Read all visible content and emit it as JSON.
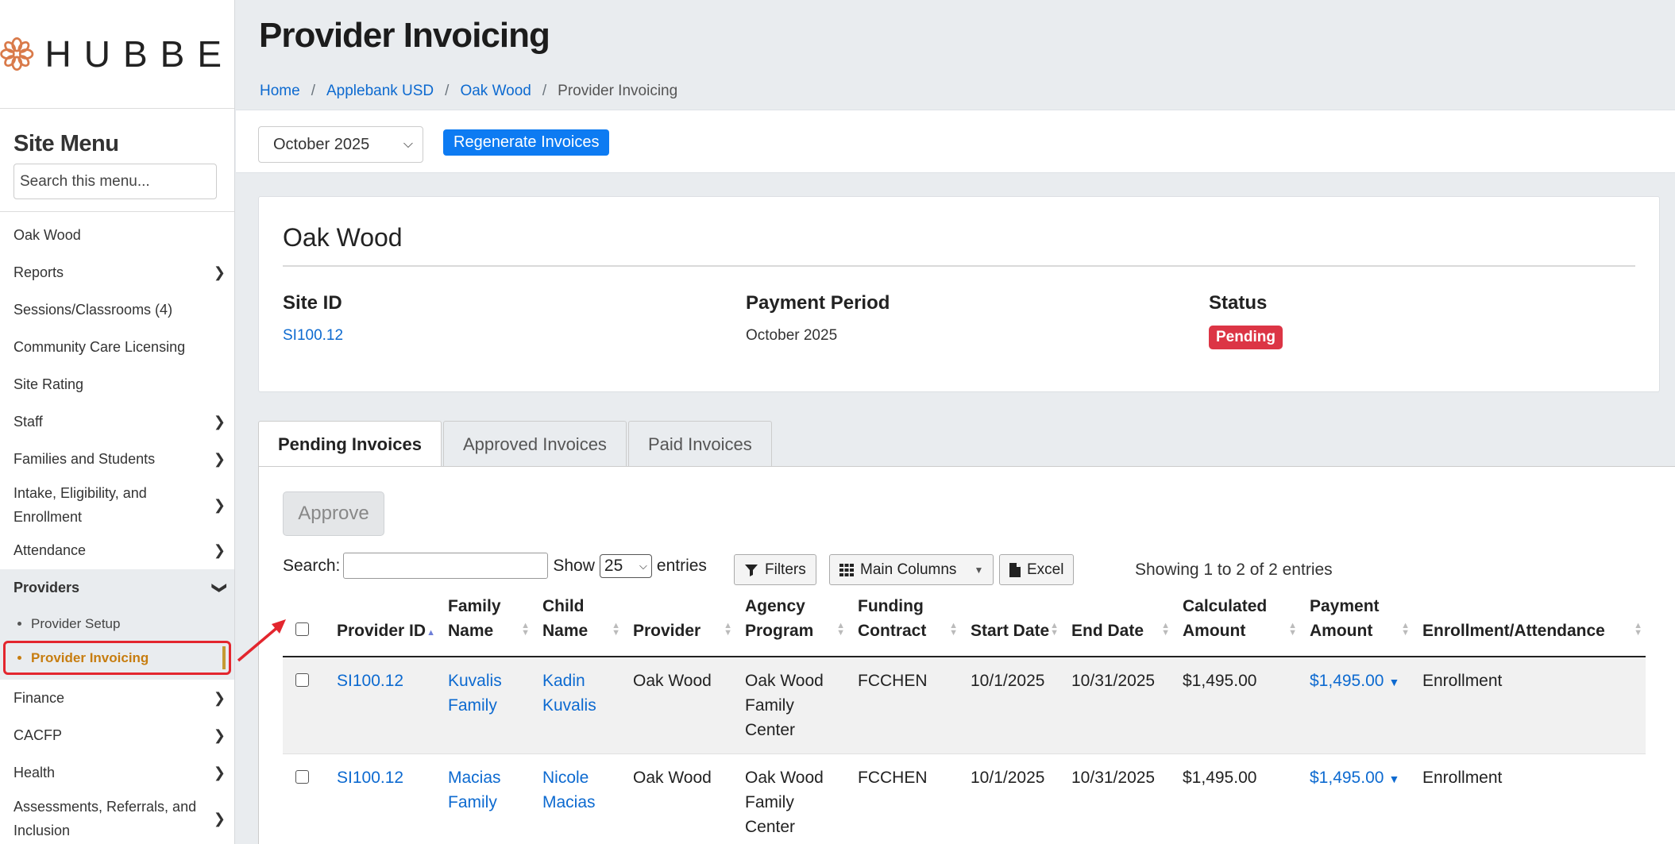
{
  "brand": {
    "logo_text": "HUBBE"
  },
  "sidebar": {
    "title": "Site Menu",
    "search_placeholder": "Search this menu...",
    "items": [
      {
        "label": "Oak Wood",
        "chevron": false
      },
      {
        "label": "Reports",
        "chevron": true
      },
      {
        "label": "Sessions/Classrooms (4)",
        "chevron": false
      },
      {
        "label": "Community Care Licensing",
        "chevron": false
      },
      {
        "label": "Site Rating",
        "chevron": false
      },
      {
        "label": "Staff",
        "chevron": true
      },
      {
        "label": "Families and Students",
        "chevron": true
      },
      {
        "label": "Intake, Eligibility, and Enrollment",
        "chevron": true
      },
      {
        "label": "Attendance",
        "chevron": true
      },
      {
        "label": "Providers",
        "chevron": true,
        "expanded": true
      },
      {
        "label": "Finance",
        "chevron": true
      },
      {
        "label": "CACFP",
        "chevron": true
      },
      {
        "label": "Health",
        "chevron": true
      },
      {
        "label": "Assessments, Referrals, and Inclusion",
        "chevron": true
      }
    ],
    "providers_sub": [
      {
        "label": "Provider Setup"
      },
      {
        "label": "Provider Invoicing",
        "current": true
      }
    ]
  },
  "header": {
    "title": "Provider Invoicing",
    "breadcrumb": [
      "Home",
      "Applebank USD",
      "Oak Wood",
      "Provider Invoicing"
    ]
  },
  "toolbar": {
    "period_value": "October 2025",
    "regenerate_label": "Regenerate Invoices"
  },
  "site_card": {
    "title": "Oak Wood",
    "site_id_label": "Site ID",
    "site_id_value": "SI100.12",
    "period_label": "Payment Period",
    "period_value": "October 2025",
    "status_label": "Status",
    "status_value": "Pending"
  },
  "tabs": [
    "Pending Invoices",
    "Approved Invoices",
    "Paid Invoices"
  ],
  "panel": {
    "approve_label": "Approve",
    "search_label": "Search:",
    "show_label": "Show",
    "entries_value": "25",
    "entries_label": "entries",
    "filters_label": "Filters",
    "columns_label": "Main Columns",
    "excel_label": "Excel",
    "showing_text": "Showing 1 to 2 of 2 entries"
  },
  "table": {
    "headers": [
      "Provider ID",
      "Family Name",
      "Child Name",
      "Provider",
      "Agency Program",
      "Funding Contract",
      "Start Date",
      "End Date",
      "Calculated Amount",
      "Payment Amount",
      "Enrollment/Attendance"
    ],
    "rows": [
      {
        "provider_id": "SI100.12",
        "family": "Kuvalis Family",
        "child": "Kadin Kuvalis",
        "provider": "Oak Wood",
        "program": "Oak Wood Family Center",
        "contract": "FCCHEN",
        "start": "10/1/2025",
        "end": "10/31/2025",
        "calculated": "$1,495.00",
        "payment": "$1,495.00",
        "type": "Enrollment"
      },
      {
        "provider_id": "SI100.12",
        "family": "Macias Family",
        "child": "Nicole Macias",
        "provider": "Oak Wood",
        "program": "Oak Wood Family Center",
        "contract": "FCCHEN",
        "start": "10/1/2025",
        "end": "10/31/2025",
        "calculated": "$1,495.00",
        "payment": "$1,495.00",
        "type": "Enrollment"
      }
    ]
  },
  "colors": {
    "accent": "#0d7bf2",
    "link": "#0d6ad0",
    "pending": "#dc3545",
    "highlight": "#c77d10",
    "annotation": "#e3262e"
  }
}
